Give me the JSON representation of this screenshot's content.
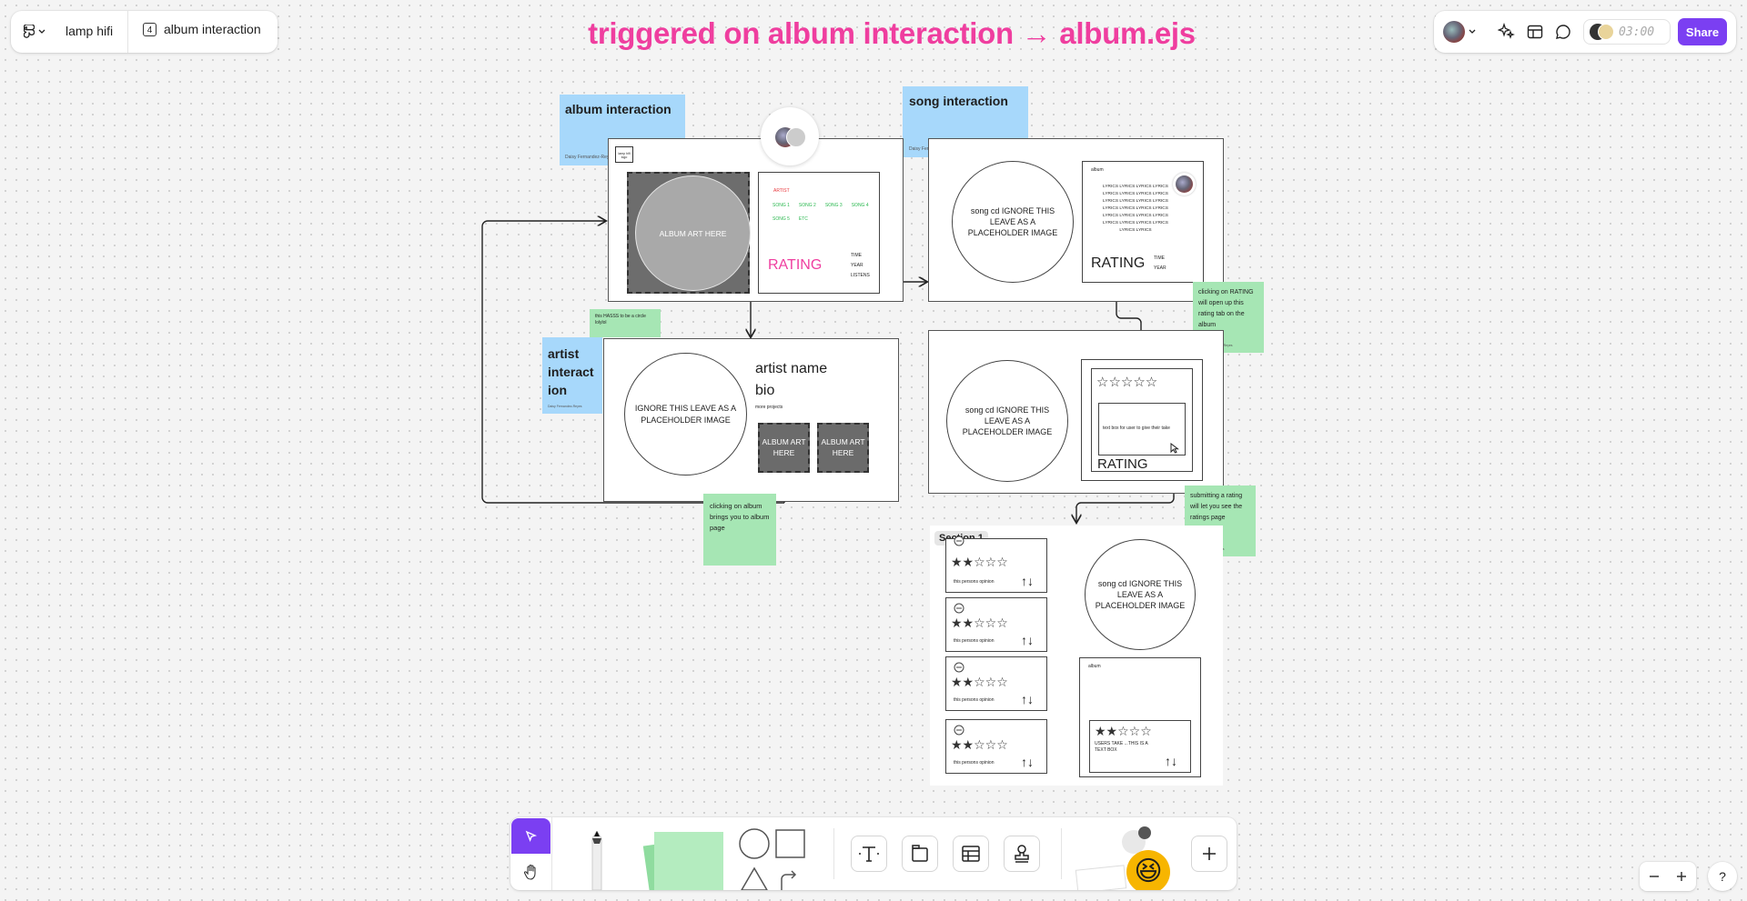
{
  "topbar": {
    "file_name": "lamp hifi",
    "page_count": "4",
    "page_name": "album interaction"
  },
  "canvas_title": "triggered on album interaction → album.ejs",
  "right_bar": {
    "timer": "03:00",
    "share_label": "Share"
  },
  "stickies": {
    "album_interaction": "album interaction",
    "song_interaction": "song interaction",
    "artist_interaction": "artist interact ion",
    "author": "Daisy Fernandez-Reyes",
    "circle_note": "this HASSS to be a circle lolylol",
    "album_note": "clicking on album brings you to album page",
    "rating_note": "clicking on RATING will open up this rating tab on the album",
    "submit_note": "submitting a rating will let you see the ratings page"
  },
  "album_frame": {
    "logo_text": "lamp hifi logo",
    "art_label": "ALBUM ART HERE",
    "artist": "ARTIST",
    "songs": [
      "SONG 1",
      "SONG 2",
      "SONG 3",
      "SONG 4",
      "SONG 5",
      "ETC"
    ],
    "rating": "RATING",
    "meta": [
      "TIME",
      "YEAR",
      "LISTENS"
    ]
  },
  "song_frame": {
    "circle_text": "song cd IGNORE THIS LEAVE AS A PLACEHOLDER IMAGE",
    "album_label": "album",
    "lyrics": "LYRICS LYRICS LYRICS LYRICS LYRICS LYRICS LYRICS LYRICS LYRICS LYRICS LYRICS LYRICS LYRICS LYRICS LYRICS LYRICS LYRICS LYRICS LYRICS LYRICS LYRICS LYRICS LYRICS LYRICS LYRICS LYRICS",
    "rating": "RATING",
    "meta": [
      "TIME",
      "YEAR"
    ]
  },
  "artist_frame": {
    "circle_text": "IGNORE THIS LEAVE AS A PLACEHOLDER IMAGE",
    "name": "artist name",
    "bio": "bio",
    "more": "more projects",
    "album1": "ALBUM ART HERE",
    "album2": "ALBUM ART HERE"
  },
  "rating_frame": {
    "circle_text": "song cd IGNORE THIS LEAVE AS A PLACEHOLDER IMAGE",
    "stars": "☆☆☆☆☆",
    "textbox": "text box for user to give their take",
    "rating": "RATING"
  },
  "section": {
    "label": "Section 1",
    "reviews": [
      {
        "stars": "★★☆☆☆",
        "text": "this persons opinion"
      },
      {
        "stars": "★★☆☆☆",
        "text": "this persons opinion"
      },
      {
        "stars": "★★☆☆☆",
        "text": "this persons opinion"
      },
      {
        "stars": "★★☆☆☆",
        "text": "this persons opinion"
      }
    ],
    "circle_text": "song cd IGNORE THIS LEAVE AS A PLACEHOLDER IMAGE",
    "album_label": "album",
    "user_stars": "★★☆☆☆",
    "user_text": "USERS TAKE ...THIS IS A TEXT BOX"
  },
  "colors": {
    "accent": "#7b3ff2",
    "title_pink": "#ef3e9f",
    "sticky_blue": "#a7d8fb",
    "sticky_green": "#a6e6b4"
  }
}
